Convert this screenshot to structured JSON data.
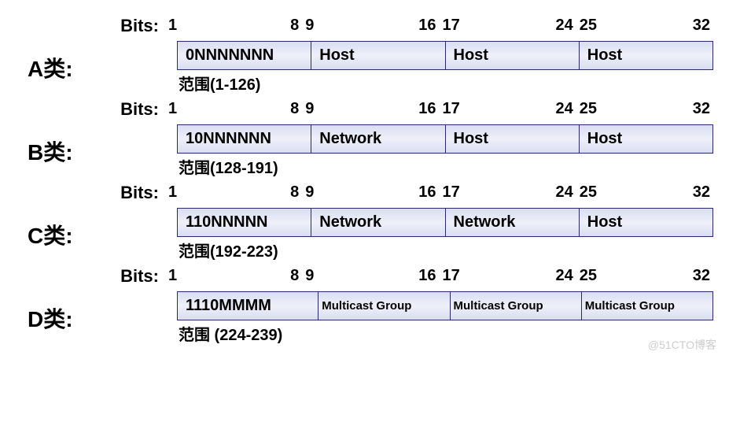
{
  "bits_label": "Bits:",
  "watermark": "@51CTO博客",
  "bit_positions": [
    {
      "start": "1",
      "end": "8"
    },
    {
      "start": "9",
      "end": "16"
    },
    {
      "start": "17",
      "end": "24"
    },
    {
      "start": "25",
      "end": "32"
    }
  ],
  "classes": [
    {
      "label": "A类:",
      "octets": [
        "0NNNNNNN",
        "Host",
        "Host",
        "Host"
      ],
      "range": "范围(1-126)",
      "small": false
    },
    {
      "label": "B类:",
      "octets": [
        "10NNNNNN",
        "Network",
        "Host",
        "Host"
      ],
      "range": "范围(128-191)",
      "small": false
    },
    {
      "label": "C类:",
      "octets": [
        "110NNNNN",
        "Network",
        "Network",
        "Host"
      ],
      "range": "范围(192-223)",
      "small": false
    },
    {
      "label": "D类:",
      "octets": [
        "1110MMMM",
        "Multicast Group",
        "Multicast Group",
        "Multicast Group"
      ],
      "range": "范围 (224-239)",
      "small": true
    }
  ]
}
